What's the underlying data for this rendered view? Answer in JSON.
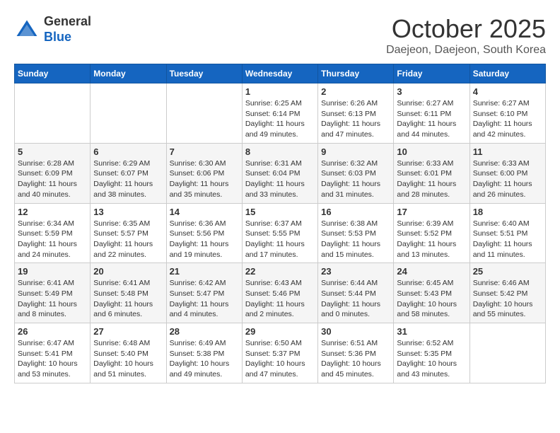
{
  "header": {
    "logo_line1": "General",
    "logo_line2": "Blue",
    "month": "October 2025",
    "location": "Daejeon, Daejeon, South Korea"
  },
  "weekdays": [
    "Sunday",
    "Monday",
    "Tuesday",
    "Wednesday",
    "Thursday",
    "Friday",
    "Saturday"
  ],
  "weeks": [
    [
      {
        "day": "",
        "info": ""
      },
      {
        "day": "",
        "info": ""
      },
      {
        "day": "",
        "info": ""
      },
      {
        "day": "1",
        "info": "Sunrise: 6:25 AM\nSunset: 6:14 PM\nDaylight: 11 hours\nand 49 minutes."
      },
      {
        "day": "2",
        "info": "Sunrise: 6:26 AM\nSunset: 6:13 PM\nDaylight: 11 hours\nand 47 minutes."
      },
      {
        "day": "3",
        "info": "Sunrise: 6:27 AM\nSunset: 6:11 PM\nDaylight: 11 hours\nand 44 minutes."
      },
      {
        "day": "4",
        "info": "Sunrise: 6:27 AM\nSunset: 6:10 PM\nDaylight: 11 hours\nand 42 minutes."
      }
    ],
    [
      {
        "day": "5",
        "info": "Sunrise: 6:28 AM\nSunset: 6:09 PM\nDaylight: 11 hours\nand 40 minutes."
      },
      {
        "day": "6",
        "info": "Sunrise: 6:29 AM\nSunset: 6:07 PM\nDaylight: 11 hours\nand 38 minutes."
      },
      {
        "day": "7",
        "info": "Sunrise: 6:30 AM\nSunset: 6:06 PM\nDaylight: 11 hours\nand 35 minutes."
      },
      {
        "day": "8",
        "info": "Sunrise: 6:31 AM\nSunset: 6:04 PM\nDaylight: 11 hours\nand 33 minutes."
      },
      {
        "day": "9",
        "info": "Sunrise: 6:32 AM\nSunset: 6:03 PM\nDaylight: 11 hours\nand 31 minutes."
      },
      {
        "day": "10",
        "info": "Sunrise: 6:33 AM\nSunset: 6:01 PM\nDaylight: 11 hours\nand 28 minutes."
      },
      {
        "day": "11",
        "info": "Sunrise: 6:33 AM\nSunset: 6:00 PM\nDaylight: 11 hours\nand 26 minutes."
      }
    ],
    [
      {
        "day": "12",
        "info": "Sunrise: 6:34 AM\nSunset: 5:59 PM\nDaylight: 11 hours\nand 24 minutes."
      },
      {
        "day": "13",
        "info": "Sunrise: 6:35 AM\nSunset: 5:57 PM\nDaylight: 11 hours\nand 22 minutes."
      },
      {
        "day": "14",
        "info": "Sunrise: 6:36 AM\nSunset: 5:56 PM\nDaylight: 11 hours\nand 19 minutes."
      },
      {
        "day": "15",
        "info": "Sunrise: 6:37 AM\nSunset: 5:55 PM\nDaylight: 11 hours\nand 17 minutes."
      },
      {
        "day": "16",
        "info": "Sunrise: 6:38 AM\nSunset: 5:53 PM\nDaylight: 11 hours\nand 15 minutes."
      },
      {
        "day": "17",
        "info": "Sunrise: 6:39 AM\nSunset: 5:52 PM\nDaylight: 11 hours\nand 13 minutes."
      },
      {
        "day": "18",
        "info": "Sunrise: 6:40 AM\nSunset: 5:51 PM\nDaylight: 11 hours\nand 11 minutes."
      }
    ],
    [
      {
        "day": "19",
        "info": "Sunrise: 6:41 AM\nSunset: 5:49 PM\nDaylight: 11 hours\nand 8 minutes."
      },
      {
        "day": "20",
        "info": "Sunrise: 6:41 AM\nSunset: 5:48 PM\nDaylight: 11 hours\nand 6 minutes."
      },
      {
        "day": "21",
        "info": "Sunrise: 6:42 AM\nSunset: 5:47 PM\nDaylight: 11 hours\nand 4 minutes."
      },
      {
        "day": "22",
        "info": "Sunrise: 6:43 AM\nSunset: 5:46 PM\nDaylight: 11 hours\nand 2 minutes."
      },
      {
        "day": "23",
        "info": "Sunrise: 6:44 AM\nSunset: 5:44 PM\nDaylight: 11 hours\nand 0 minutes."
      },
      {
        "day": "24",
        "info": "Sunrise: 6:45 AM\nSunset: 5:43 PM\nDaylight: 10 hours\nand 58 minutes."
      },
      {
        "day": "25",
        "info": "Sunrise: 6:46 AM\nSunset: 5:42 PM\nDaylight: 10 hours\nand 55 minutes."
      }
    ],
    [
      {
        "day": "26",
        "info": "Sunrise: 6:47 AM\nSunset: 5:41 PM\nDaylight: 10 hours\nand 53 minutes."
      },
      {
        "day": "27",
        "info": "Sunrise: 6:48 AM\nSunset: 5:40 PM\nDaylight: 10 hours\nand 51 minutes."
      },
      {
        "day": "28",
        "info": "Sunrise: 6:49 AM\nSunset: 5:38 PM\nDaylight: 10 hours\nand 49 minutes."
      },
      {
        "day": "29",
        "info": "Sunrise: 6:50 AM\nSunset: 5:37 PM\nDaylight: 10 hours\nand 47 minutes."
      },
      {
        "day": "30",
        "info": "Sunrise: 6:51 AM\nSunset: 5:36 PM\nDaylight: 10 hours\nand 45 minutes."
      },
      {
        "day": "31",
        "info": "Sunrise: 6:52 AM\nSunset: 5:35 PM\nDaylight: 10 hours\nand 43 minutes."
      },
      {
        "day": "",
        "info": ""
      }
    ]
  ]
}
